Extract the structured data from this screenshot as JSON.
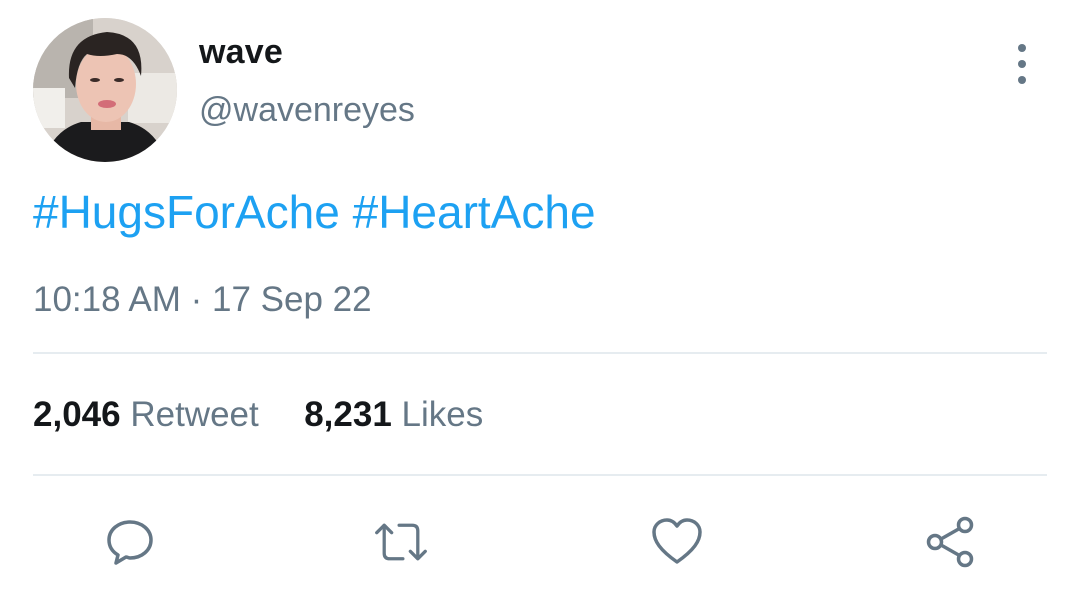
{
  "user": {
    "display_name": "wave",
    "handle": "@wavenreyes",
    "avatar_icon": "profile-photo"
  },
  "tweet": {
    "hashtags": [
      "#HugsForAche",
      "#HeartAche"
    ],
    "time": "10:18 AM",
    "separator": "·",
    "date": "17 Sep 22"
  },
  "stats": {
    "retweets_count": "2,046",
    "retweets_label": "Retweet",
    "likes_count": "8,231",
    "likes_label": "Likes"
  },
  "actions": {
    "reply_icon": "speech-bubble-icon",
    "retweet_icon": "retweet-arrows-icon",
    "like_icon": "heart-icon",
    "share_icon": "share-nodes-icon"
  },
  "colors": {
    "link": "#1da1f2",
    "secondary_text": "#657786",
    "primary_text": "#14171a",
    "divider": "#e6ecf0"
  }
}
